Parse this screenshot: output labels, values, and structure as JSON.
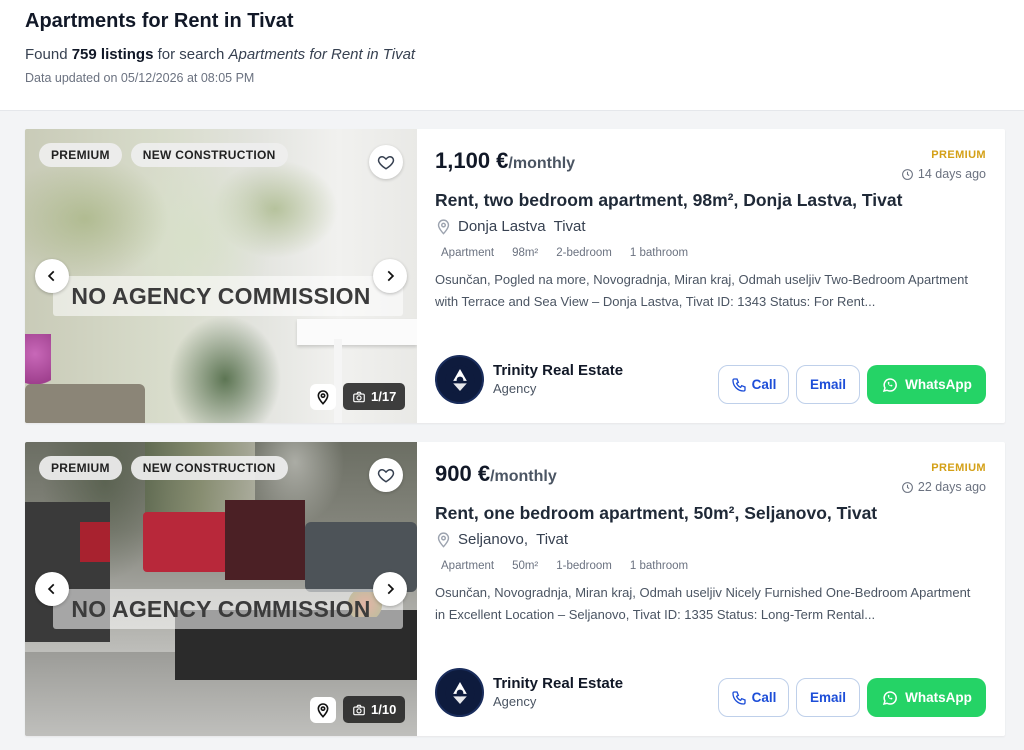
{
  "header": {
    "title": "Apartments for Rent in Tivat",
    "found_prefix": "Found",
    "found_count": "759 listings",
    "found_middle": "for search",
    "found_query": "Apartments for Rent in Tivat",
    "updated": "Data updated on 05/12/2026 at 08:05 PM"
  },
  "colors": {
    "premium": "#d4a017",
    "whatsapp": "#25d366",
    "link": "#1d4ed8"
  },
  "listings": [
    {
      "badges": [
        "PREMIUM",
        "NEW CONSTRUCTION"
      ],
      "overlay": "NO AGENCY COMMISSION",
      "photo_count": "1/17",
      "price": "1,100 €",
      "period": "/monthly",
      "premium_label": "PREMIUM",
      "days_ago": "14 days ago",
      "title": "Rent, two bedroom apartment, 98m², Donja Lastva, Tivat",
      "location": "Donja Lastva  Tivat",
      "features": [
        "Apartment",
        "98m²",
        "2-bedroom",
        "1 bathroom"
      ],
      "description": "Osunčan, Pogled na more, Novogradnja, Miran kraj, Odmah useljiv Two-Bedroom Apartment with Terrace and Sea View – Donja Lastva, Tivat ID: 1343 Status: For Rent...",
      "agent_name": "Trinity Real Estate",
      "agent_type": "Agency",
      "call_label": "Call",
      "email_label": "Email",
      "whatsapp_label": "WhatsApp"
    },
    {
      "badges": [
        "PREMIUM",
        "NEW CONSTRUCTION"
      ],
      "overlay": "NO AGENCY COMMISSION",
      "photo_count": "1/10",
      "price": "900 €",
      "period": "/monthly",
      "premium_label": "PREMIUM",
      "days_ago": "22 days ago",
      "title": "Rent, one bedroom apartment, 50m², Seljanovo, Tivat",
      "location": "Seljanovo,  Tivat",
      "features": [
        "Apartment",
        "50m²",
        "1-bedroom",
        "1 bathroom"
      ],
      "description": "Osunčan, Novogradnja, Miran kraj, Odmah useljiv Nicely Furnished One-Bedroom Apartment in Excellent Location – Seljanovo, Tivat ID: 1335 Status: Long-Term Rental...",
      "agent_name": "Trinity Real Estate",
      "agent_type": "Agency",
      "call_label": "Call",
      "email_label": "Email",
      "whatsapp_label": "WhatsApp"
    }
  ]
}
